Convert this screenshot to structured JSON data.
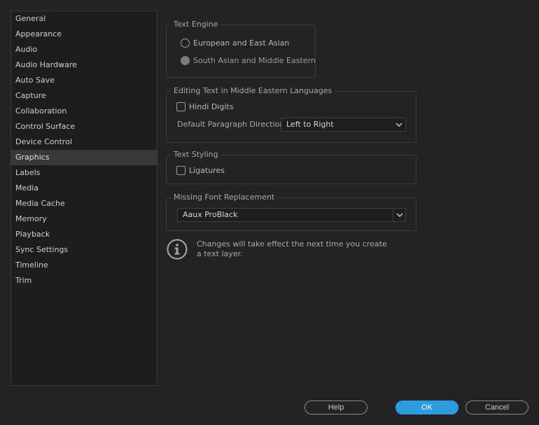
{
  "sidebar": {
    "items": [
      {
        "label": "General"
      },
      {
        "label": "Appearance"
      },
      {
        "label": "Audio"
      },
      {
        "label": "Audio Hardware"
      },
      {
        "label": "Auto Save"
      },
      {
        "label": "Capture"
      },
      {
        "label": "Collaboration"
      },
      {
        "label": "Control Surface"
      },
      {
        "label": "Device Control"
      },
      {
        "label": "Graphics"
      },
      {
        "label": "Labels"
      },
      {
        "label": "Media"
      },
      {
        "label": "Media Cache"
      },
      {
        "label": "Memory"
      },
      {
        "label": "Playback"
      },
      {
        "label": "Sync Settings"
      },
      {
        "label": "Timeline"
      },
      {
        "label": "Trim"
      }
    ],
    "selected": "Graphics"
  },
  "text_engine": {
    "title": "Text Engine",
    "options": [
      {
        "label": "European and East Asian",
        "checked": false
      },
      {
        "label": "South Asian and Middle Eastern",
        "checked": true
      }
    ]
  },
  "middle_eastern": {
    "title": "Editing Text in Middle Eastern Languages",
    "hindi_digits_label": "Hindi Digits",
    "hindi_digits_checked": false,
    "direction_label": "Default Paragraph Direction:",
    "direction_value": "Left to Right"
  },
  "text_styling": {
    "title": "Text Styling",
    "ligatures_label": "Ligatures",
    "ligatures_checked": false
  },
  "missing_font": {
    "title": "Missing Font Replacement",
    "value": "Aaux ProBlack"
  },
  "info": {
    "icon": "info-icon",
    "message": "Changes will take effect the next time you create a text layer."
  },
  "footer": {
    "help_label": "Help",
    "ok_label": "OK",
    "cancel_label": "Cancel"
  },
  "colors": {
    "background": "#232323",
    "primary_button": "#2d9be0",
    "selection": "#383838"
  }
}
